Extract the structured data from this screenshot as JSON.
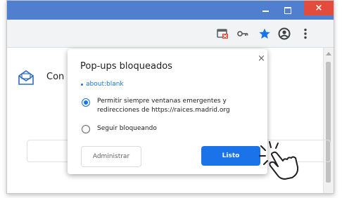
{
  "window": {
    "close_symbol": "×"
  },
  "toolbar": {
    "icons": [
      "popup-blocked-icon",
      "key-icon",
      "star-icon",
      "account-icon",
      "menu-icon"
    ],
    "accent": "#1a73e8"
  },
  "page": {
    "partial_label": "Con"
  },
  "popup": {
    "title": "Pop-ups bloqueados",
    "close_symbol": "×",
    "blocked_link": "about:blank",
    "option_allow": "Permitir siempre ventanas emergentes y redirecciones de https://raices.madrid.org",
    "option_allow_selected": true,
    "option_block": "Seguir bloqueando",
    "option_block_selected": false,
    "button_manage": "Administrar",
    "button_done": "Listo"
  },
  "colors": {
    "titlebar": "#4f7fce",
    "close_button": "#e34c3c",
    "primary_button": "#1a73e8"
  }
}
